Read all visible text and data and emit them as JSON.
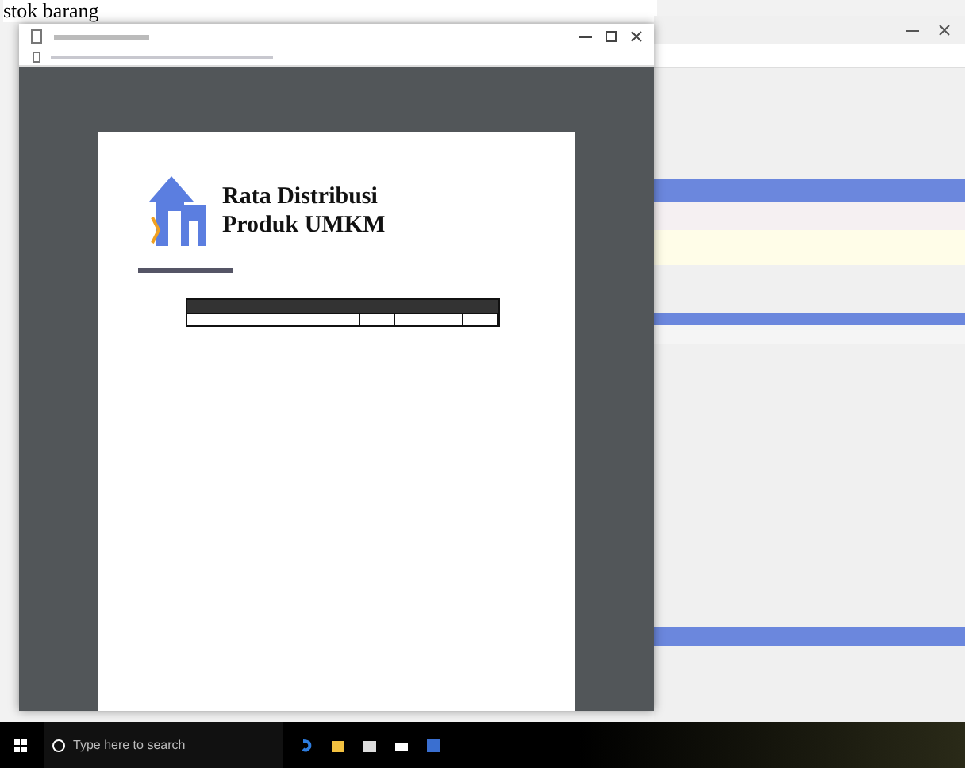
{
  "background_heading": "stok barang",
  "report": {
    "title_lines": [
      "Rata Distribusi",
      "Produk UMKM"
    ]
  },
  "taskbar": {
    "search_placeholder": "Type here to search"
  }
}
